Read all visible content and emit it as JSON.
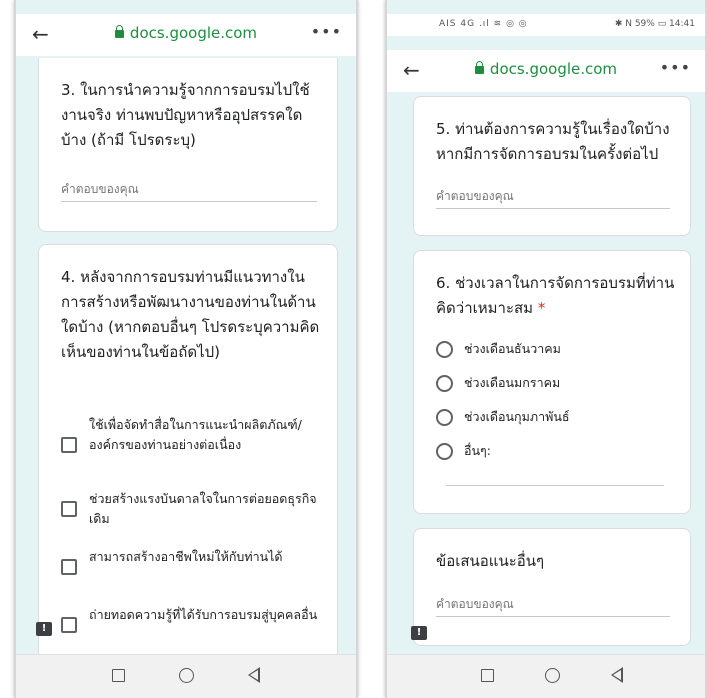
{
  "left": {
    "url": "docs.google.com",
    "question3": {
      "title": "3. ในการนำความรู้จากการอบรมไปใช้งานจริง ท่านพบปัญหาหรืออุปสรรคใดบ้าง (ถ้ามี โปรดระบุ)",
      "placeholder": "คำตอบของคุณ"
    },
    "question4": {
      "title": "4. หลังจากการอบรมท่านมีแนวทางในการสร้างหรือพัฒนางานของท่านในด้านใดบ้าง (หากตอบอื่นๆ โปรดระบุความคิดเห็นของท่านในข้อถัดไป)",
      "options": [
        "ใช้เพื่อจัดทำสื่อในการแนะนำผลิตภัณฑ์/องค์กรของท่านอย่างต่อเนื่อง",
        "ช่วยสร้างแรงบันดาลใจในการต่อยอดธุรกิจเดิม",
        "สามารถสร้างอาชีพใหม่ให้กับท่านได้",
        "ถ่ายทอดความรู้ที่ได้รับการอบรมสู่บุคคลอื่น"
      ]
    }
  },
  "right": {
    "status_left": "AIS 4G .ıl ≋ ◎ ◎",
    "status_right": "✱ N 59% ▭ 14:41",
    "url": "docs.google.com",
    "question5": {
      "title": "5. ท่านต้องการความรู้ในเรื่องใดบ้าง หากมีการจัดการอบรมในครั้งต่อไป",
      "placeholder": "คำตอบของคุณ"
    },
    "question6": {
      "title": "6. ช่วงเวลาในการจัดการอบรมที่ท่านคิดว่าเหมาะสม",
      "required": "*",
      "options": [
        "ช่วงเดือนธันวาคม",
        "ช่วงเดือนมกราคม",
        "ช่วงเดือนกุมภาพันธ์",
        "อื่นๆ:"
      ]
    },
    "suggestion": {
      "title": "ข้อเสนอแนะอื่นๆ",
      "placeholder": "คำตอบของคุณ"
    }
  },
  "icons": {
    "back": "arrow-left-icon",
    "lock": "lock-icon",
    "menu": "more-horizontal-icon",
    "feedback": "feedback-icon"
  },
  "colors": {
    "url": "#1e8e3e",
    "background": "#e4f4f5",
    "required": "#d93025"
  }
}
